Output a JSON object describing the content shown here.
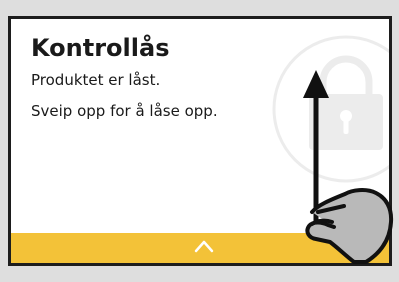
{
  "lock_screen": {
    "title": "Kontrollås",
    "message_line_1": "Produktet er låst.",
    "message_line_2": "Sveip opp for å låse opp."
  },
  "icons": {
    "watermark": "lock-icon",
    "bar": "chevron-up-icon",
    "gesture": "swipe-up-hand-icon"
  },
  "colors": {
    "accent_bar": "#f3c238",
    "text": "#1a1a1a",
    "border": "#1d1d1d",
    "watermark": "#ececec"
  }
}
